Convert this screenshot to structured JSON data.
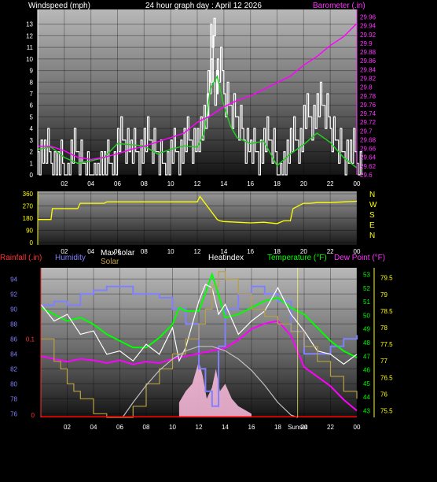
{
  "colors": {
    "wind_speed": "#ffffff",
    "wind_avg": "#22cc22",
    "barometer": "#ff00ff",
    "direction": "#ffff00",
    "humidity": "#8080ff",
    "temperature": "#00ff00",
    "dew_point": "#ff00ff",
    "heat_index": "#ffffff",
    "rainfall": "#ff0000",
    "max_solar": "#c0c0c0",
    "solar": "#ffff66",
    "solar_fill": "#ffc0e0"
  },
  "chart_data": [
    {
      "type": "line",
      "title": "24 hour graph day : April 12 2026",
      "ylabel_left": "Windspeed (mph)",
      "ylabel_right": "Barometer (.in)",
      "x_ticks": [
        "02",
        "04",
        "06",
        "08",
        "10",
        "12",
        "14",
        "16",
        "18",
        "20",
        "22",
        "00"
      ],
      "x_range": [
        0,
        24
      ],
      "y_left_range": [
        0,
        14
      ],
      "y_left_ticks": [
        "0",
        "1",
        "2",
        "3",
        "4",
        "5",
        "6",
        "7",
        "8",
        "9",
        "10",
        "11",
        "12",
        "13"
      ],
      "y_right_range": [
        29.6,
        29.97
      ],
      "y_right_ticks": [
        "29.6",
        "29.62",
        "29.64",
        "29.66",
        "29.68",
        "29.7",
        "29.72",
        "29.74",
        "29.76",
        "29.78",
        "29.8",
        "29.82",
        "29.84",
        "29.86",
        "29.88",
        "29.9",
        "29.92",
        "29.94",
        "29.96"
      ],
      "series": [
        {
          "name": "Windspeed",
          "axis": "left",
          "x": [
            0,
            0.5,
            1,
            1.5,
            2,
            2.5,
            3,
            3.5,
            4,
            4.5,
            5,
            5.5,
            6,
            6.5,
            7,
            7.5,
            8,
            8.5,
            9,
            9.5,
            10,
            10.5,
            11,
            11.5,
            12,
            12.5,
            12.8,
            13,
            13.2,
            13.5,
            14,
            14.5,
            15,
            15.5,
            16,
            16.5,
            17,
            17.5,
            18,
            18.5,
            19,
            19.5,
            20,
            20.5,
            21,
            21.5,
            22,
            22.5,
            23,
            23.5,
            24
          ],
          "values": [
            2,
            3,
            1,
            2,
            0,
            3,
            2,
            1,
            0,
            1,
            2,
            1,
            4,
            3,
            3,
            2,
            4,
            3,
            2,
            1,
            3,
            2,
            4,
            3,
            4,
            6,
            9,
            13,
            8,
            10,
            7,
            6,
            5,
            3,
            3,
            2,
            4,
            3,
            0,
            2,
            4,
            3,
            6,
            5,
            7,
            6,
            4,
            3,
            2,
            3,
            1
          ]
        },
        {
          "name": "Wind average",
          "axis": "left",
          "x": [
            0,
            1,
            2,
            3,
            4,
            5,
            6,
            7,
            8,
            9,
            10,
            11,
            12,
            12.5,
            13,
            13.5,
            14,
            14.5,
            15,
            16,
            17,
            18,
            19,
            20,
            21,
            22,
            23,
            24
          ],
          "values": [
            2.2,
            2.4,
            1.5,
            1.0,
            1.2,
            1.5,
            2.7,
            2.6,
            2.5,
            1.8,
            2.2,
            2.5,
            2.4,
            3.5,
            7.5,
            8.5,
            6.0,
            4.2,
            3.2,
            2.7,
            2.9,
            0.8,
            1.8,
            2.6,
            3.6,
            2.8,
            1.5,
            0.6
          ]
        },
        {
          "name": "Barometer",
          "axis": "right",
          "x": [
            0,
            1,
            2,
            3,
            4,
            5,
            6,
            7,
            8,
            9,
            10,
            11,
            12,
            13,
            14,
            15,
            16,
            17,
            18,
            19,
            20,
            21,
            22,
            23,
            24
          ],
          "values": [
            29.665,
            29.665,
            29.655,
            29.64,
            29.635,
            29.64,
            29.648,
            29.658,
            29.665,
            29.675,
            29.685,
            29.695,
            29.72,
            29.735,
            29.755,
            29.77,
            29.78,
            29.795,
            29.81,
            29.825,
            29.85,
            29.87,
            29.895,
            29.915,
            29.945
          ]
        }
      ]
    },
    {
      "type": "line",
      "ylabel_right": "N W S E N",
      "y_ticks": [
        "0",
        "90",
        "180",
        "270",
        "360"
      ],
      "y_range": [
        0,
        360
      ],
      "x_range": [
        0,
        24
      ],
      "x_ticks": [
        "02",
        "04",
        "06",
        "08",
        "10",
        "12",
        "14",
        "16",
        "18",
        "20",
        "22",
        "00"
      ],
      "compass": [
        "N",
        "W",
        "S",
        "E",
        "N"
      ],
      "series": [
        {
          "name": "Wind direction",
          "x": [
            0,
            1,
            1.1,
            2,
            3,
            3.2,
            5,
            5.2,
            6,
            8,
            10,
            12,
            12.2,
            13.5,
            13.7,
            14,
            15,
            16,
            17,
            18,
            18.5,
            19,
            19.2,
            20,
            20.5,
            21,
            22,
            23,
            24
          ],
          "values": [
            170,
            170,
            250,
            250,
            250,
            290,
            290,
            300,
            300,
            300,
            300,
            300,
            340,
            170,
            160,
            155,
            150,
            145,
            150,
            140,
            160,
            160,
            250,
            290,
            290,
            295,
            295,
            300,
            305
          ]
        }
      ]
    },
    {
      "type": "line",
      "labels_top": [
        "Rainfall (.in)",
        "Humidity",
        "Max solar",
        "Solar",
        "Heatindex",
        "Temperature (°F)",
        "Dew Point (°F)"
      ],
      "x_ticks": [
        "02",
        "04",
        "06",
        "08",
        "10",
        "12",
        "14",
        "16",
        "18",
        "20",
        "22",
        "00"
      ],
      "x_range": [
        0,
        24
      ],
      "sunset_label": "Sunset",
      "sunset_x": 19.5,
      "humidity_ticks": [
        "76",
        "78",
        "80",
        "82",
        "84",
        "86",
        "88",
        "90",
        "92",
        "94"
      ],
      "humidity_range": [
        75.5,
        95.5
      ],
      "rain_ticks": [
        "0",
        "0.1"
      ],
      "dew_ticks": [
        "43",
        "44",
        "45",
        "46",
        "47",
        "48",
        "49",
        "50",
        "51",
        "52",
        "53"
      ],
      "dew_range": [
        42.5,
        53.5
      ],
      "temp_ticks": [
        "75.5",
        "76",
        "76.5",
        "77",
        "77.5",
        "78",
        "78.5",
        "79",
        "79.5"
      ],
      "temp_range": [
        75.3,
        79.8
      ],
      "series": [
        {
          "name": "Humidity",
          "axis": "humidity",
          "x": [
            0,
            1,
            2,
            3,
            4,
            5,
            6,
            7,
            8,
            9,
            10,
            11,
            12,
            12.5,
            13,
            13.5,
            14,
            15,
            16,
            17,
            18,
            19,
            20,
            21,
            22,
            23,
            24
          ],
          "values": [
            90.5,
            91,
            90.5,
            92,
            92.5,
            93,
            93,
            92,
            92,
            91.5,
            90,
            88,
            82,
            79,
            77,
            85,
            90,
            92,
            93,
            92,
            91,
            87,
            84,
            84,
            85,
            86,
            86.5
          ]
        },
        {
          "name": "Temperature",
          "axis": "temp",
          "x": [
            0,
            1,
            2,
            3,
            4,
            5,
            6,
            7,
            8,
            9,
            10,
            10.5,
            11,
            12,
            13,
            13.5,
            14,
            15,
            16,
            17,
            18,
            19,
            20,
            21,
            22,
            23,
            24
          ],
          "values": [
            78.6,
            78.4,
            78.2,
            78.3,
            78.1,
            77.8,
            77.6,
            77.4,
            77.4,
            77.7,
            78.1,
            78.6,
            78.5,
            78.5,
            79.6,
            79,
            78.3,
            78.4,
            78.6,
            78.8,
            78.9,
            78.6,
            78.4,
            78,
            77.6,
            77.3,
            77.1
          ]
        },
        {
          "name": "Dew Point",
          "axis": "dew",
          "x": [
            0,
            1,
            2,
            3,
            4,
            5,
            6,
            7,
            8,
            9,
            10,
            11,
            12,
            13,
            14,
            15,
            16,
            17,
            18,
            19,
            20,
            21,
            22,
            23,
            24
          ],
          "values": [
            47,
            46.8,
            46.6,
            46.8,
            46.7,
            46.5,
            46.7,
            46.4,
            46.6,
            46.5,
            46.8,
            47,
            47.2,
            47.4,
            47.6,
            48.2,
            49,
            49.4,
            49.6,
            48.5,
            46.2,
            45.5,
            44.8,
            43.8,
            43
          ]
        },
        {
          "name": "Heatindex",
          "axis": "temp",
          "x": [
            0,
            1,
            2,
            3,
            4,
            5,
            6,
            7,
            8,
            9,
            10,
            10.5,
            11,
            12,
            12.5,
            13,
            13.5,
            14,
            15,
            16,
            17,
            18,
            18.5,
            19,
            20,
            21,
            22,
            23,
            24
          ],
          "values": [
            78.7,
            78.2,
            78.4,
            77.8,
            77.9,
            77.2,
            77.3,
            77,
            77.5,
            77.2,
            78,
            77,
            77.4,
            78.8,
            79.3,
            79.2,
            78.4,
            78.7,
            77.8,
            78.2,
            78.5,
            79.2,
            78.8,
            78.4,
            77.9,
            77.3,
            77.2,
            76.9,
            77.2
          ]
        },
        {
          "name": "Solar",
          "axis": "humidity",
          "x": [
            0,
            1,
            1.5,
            2,
            2.5,
            3,
            4,
            5,
            6,
            7,
            8,
            9,
            10,
            11,
            12,
            12.5,
            13,
            13.5,
            14,
            15,
            16,
            17,
            18,
            19,
            20,
            21,
            22,
            23,
            24
          ],
          "values": [
            86,
            83,
            82,
            80,
            79,
            78,
            76,
            75.5,
            75.5,
            77,
            80,
            82,
            84,
            86,
            88,
            90,
            93,
            95,
            94,
            92,
            90,
            89,
            88,
            87,
            85,
            83,
            81,
            79,
            78
          ]
        },
        {
          "name": "Max solar",
          "axis": "humidity",
          "x": [
            6.2,
            7,
            8,
            9,
            10,
            11,
            12,
            13,
            14,
            15,
            16,
            17,
            18,
            19,
            19.5
          ],
          "values": [
            75.5,
            77.5,
            79.8,
            81.8,
            83.3,
            84.4,
            85,
            85,
            84.4,
            83.3,
            81.8,
            79.8,
            77.5,
            75.8,
            75.5
          ]
        },
        {
          "name": "Rainfall",
          "axis": "humidity",
          "x": [
            0,
            24
          ],
          "values": [
            75.6,
            75.6
          ]
        }
      ]
    }
  ]
}
